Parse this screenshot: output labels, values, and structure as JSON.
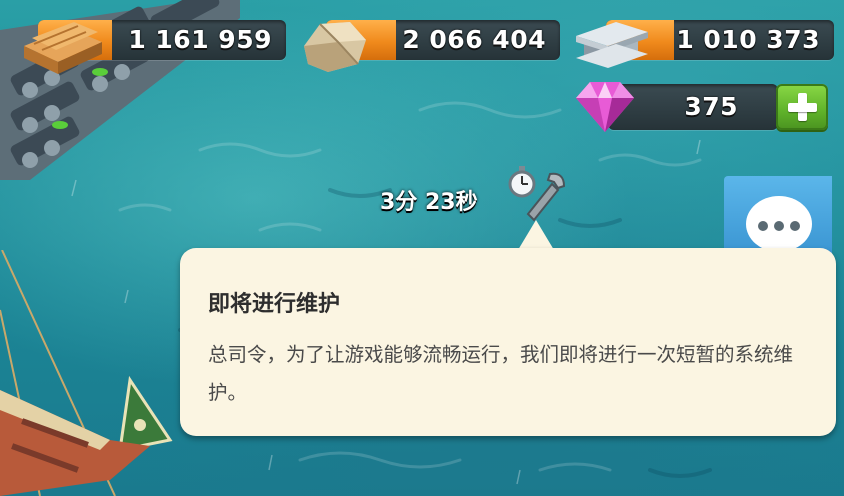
{
  "resources": {
    "wood": {
      "icon": "wood-planks-icon",
      "value": "1 161 959",
      "fill_fraction": 0.3
    },
    "stone": {
      "icon": "stone-icon",
      "value": "2 066 404",
      "fill_fraction": 0.3
    },
    "iron": {
      "icon": "iron-ingot-icon",
      "value": "1 010 373",
      "fill_fraction": 0.3
    },
    "diamonds": {
      "icon": "diamond-icon",
      "value": "375"
    }
  },
  "add_diamonds_icon": "plus-icon",
  "maintenance_timer": {
    "text": "3分 23秒",
    "icons": [
      "stopwatch-icon",
      "wrench-icon"
    ]
  },
  "chat_icon": "chat-bubble-icon",
  "tooltip": {
    "title": "即将进行维护",
    "body": "总司令，为了让游戏能够流畅运行，我们即将进行一次短暂的系统维护。"
  },
  "colors": {
    "sea": "#1f8b9a",
    "resource_fill": "#f08a1c",
    "plus_button": "#5fb22a",
    "chat_button": "#3a95d2",
    "tooltip_bg": "#fbf5e2"
  }
}
